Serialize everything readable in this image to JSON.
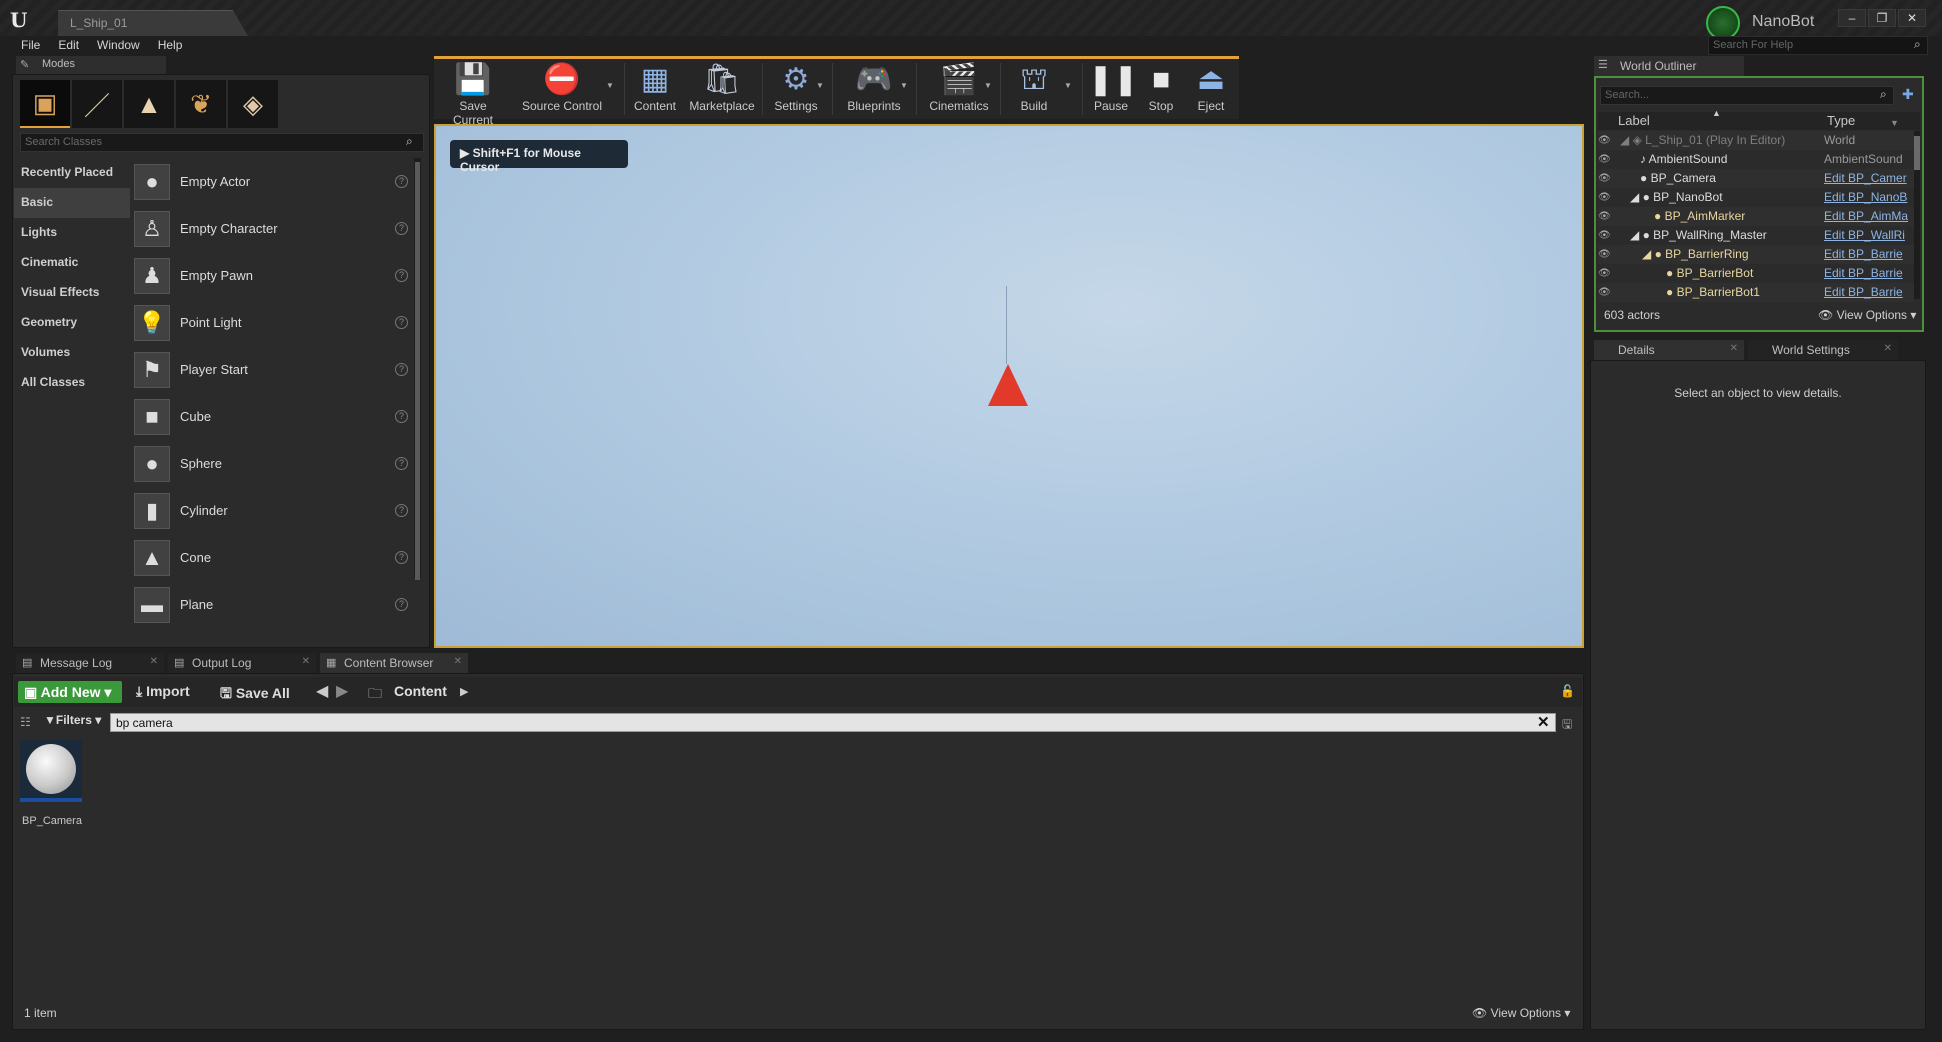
{
  "window": {
    "tab_title": "L_Ship_01",
    "project_name": "NanoBot",
    "help_search_placeholder": "Search For Help",
    "controls": [
      "–",
      "❐",
      "✕"
    ]
  },
  "menu": [
    "File",
    "Edit",
    "Window",
    "Help"
  ],
  "modes": {
    "tab_label": "Modes",
    "search_placeholder": "Search Classes",
    "categories": [
      "Recently Placed",
      "Basic",
      "Lights",
      "Cinematic",
      "Visual Effects",
      "Geometry",
      "Volumes",
      "All Classes"
    ],
    "active_category": "Basic",
    "classes": [
      {
        "label": "Empty Actor",
        "icon": "sphere-icon"
      },
      {
        "label": "Empty Character",
        "icon": "character-icon"
      },
      {
        "label": "Empty Pawn",
        "icon": "pawn-icon"
      },
      {
        "label": "Point Light",
        "icon": "light-bulb-icon"
      },
      {
        "label": "Player Start",
        "icon": "player-start-icon"
      },
      {
        "label": "Cube",
        "icon": "cube-icon"
      },
      {
        "label": "Sphere",
        "icon": "sphere-icon"
      },
      {
        "label": "Cylinder",
        "icon": "cylinder-icon"
      },
      {
        "label": "Cone",
        "icon": "cone-icon"
      },
      {
        "label": "Plane",
        "icon": "plane-icon"
      }
    ]
  },
  "toolbar": {
    "items": [
      {
        "label": "Save Current",
        "icon": "save-icon",
        "has_menu": false
      },
      {
        "label": "Source Control",
        "icon": "source-control-icon",
        "has_menu": true
      },
      {
        "label": "Content",
        "icon": "content-icon",
        "has_menu": false
      },
      {
        "label": "Marketplace",
        "icon": "marketplace-icon",
        "has_menu": false
      },
      {
        "label": "Settings",
        "icon": "settings-icon",
        "has_menu": true
      },
      {
        "label": "Blueprints",
        "icon": "blueprints-icon",
        "has_menu": true
      },
      {
        "label": "Cinematics",
        "icon": "cinematics-icon",
        "has_menu": true
      },
      {
        "label": "Build",
        "icon": "build-icon",
        "has_menu": true
      },
      {
        "label": "Pause",
        "icon": "pause-icon",
        "has_menu": false
      },
      {
        "label": "Stop",
        "icon": "stop-icon",
        "has_menu": false
      },
      {
        "label": "Eject",
        "icon": "eject-icon",
        "has_menu": false
      }
    ],
    "accent": "#e4a13a"
  },
  "viewport": {
    "hint": "Shift+F1 for Mouse Cursor"
  },
  "outliner": {
    "tab_label": "World Outliner",
    "search_placeholder": "Search...",
    "col_label": "Label",
    "col_type": "Type",
    "rows": [
      {
        "label": "L_Ship_01 (Play In Editor)",
        "type": "World",
        "indent": 0,
        "link": false
      },
      {
        "label": "AmbientSound",
        "type": "AmbientSound",
        "indent": 1,
        "link": false
      },
      {
        "label": "BP_Camera",
        "type": "Edit BP_Camer",
        "indent": 1,
        "link": true
      },
      {
        "label": "BP_NanoBot",
        "type": "Edit BP_NanoB",
        "indent": 1,
        "link": true
      },
      {
        "label": "BP_AimMarker",
        "type": "Edit BP_AimMa",
        "indent": 2,
        "link": true
      },
      {
        "label": "BP_WallRing_Master",
        "type": "Edit BP_WallRi",
        "indent": 1,
        "link": true
      },
      {
        "label": "BP_BarrierRing",
        "type": "Edit BP_Barrie",
        "indent": 2,
        "link": true
      },
      {
        "label": "BP_BarrierBot",
        "type": "Edit BP_Barrie",
        "indent": 3,
        "link": true
      },
      {
        "label": "BP_BarrierBot1",
        "type": "Edit BP_Barrie",
        "indent": 3,
        "link": true
      }
    ],
    "count": "603 actors",
    "view_options": "View Options"
  },
  "details": {
    "tabs": [
      "Details",
      "World Settings"
    ],
    "empty_text": "Select an object to view details."
  },
  "bottom_tabs": [
    "Message Log",
    "Output Log",
    "Content Browser"
  ],
  "content_browser": {
    "add_new": "Add New",
    "import": "Import",
    "save_all": "Save All",
    "path": "Content",
    "filters": "Filters",
    "search_value": "bp camera",
    "assets": [
      {
        "name": "BP_Camera"
      }
    ],
    "count": "1 item",
    "view_options": "View Options"
  }
}
